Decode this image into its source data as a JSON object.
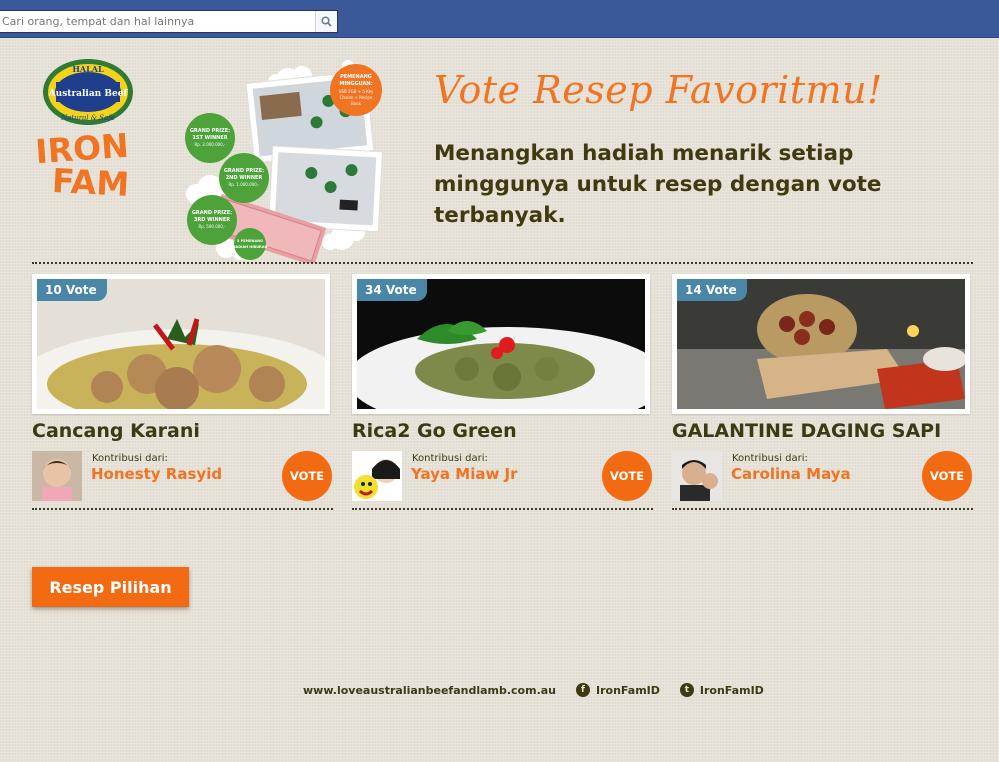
{
  "search": {
    "placeholder": "Cari orang, tempat dan hal lainnya"
  },
  "brand": {
    "halal_top": "HALAL",
    "halal_middle": "Australian Beef",
    "halal_bottom": "Natural & Safe",
    "ironfam_line1": "IRON",
    "ironfam_line2": "FAM"
  },
  "collage": {
    "weekly_winner": "PEMENANG MINGGUAN:",
    "weekly_prize": "USB 2GB + 5 Key Chains + Recipe Book",
    "grand1": "GRAND PRIZE: 1ST WINNER",
    "grand1_amount": "Uang Tunai Rp. 2.000.000,-",
    "grand2": "GRAND PRIZE: 2ND WINNER",
    "grand2_amount": "Uang Tunai Rp. 1.000.000,-",
    "grand3": "GRAND PRIZE: 3RD WINNER",
    "grand3_amount": "Uang Tunai Rp. 500.000,-",
    "consolation": "5 PEMENANG HADIAH HIBURAN"
  },
  "header": {
    "title": "Vote Resep Favoritmu!",
    "subtitle": "Menangkan hadiah menarik setiap minggunya untuk resep dengan vote terbanyak."
  },
  "recipes": [
    {
      "votes": "10 Vote",
      "title": "Cancang Karani",
      "contrib_label": "Kontribusi dari:",
      "contributor": "Honesty Rasyid",
      "vote_label": "VOTE"
    },
    {
      "votes": "34 Vote",
      "title": "Rica2 Go Green",
      "contrib_label": "Kontribusi dari:",
      "contributor": "Yaya Miaw Jr",
      "vote_label": "VOTE"
    },
    {
      "votes": "14 Vote",
      "title": "GALANTINE DAGING SAPI",
      "contrib_label": "Kontribusi dari:",
      "contributor": "Carolina Maya",
      "vote_label": "VOTE"
    }
  ],
  "resep_button": "Resep Pilihan",
  "footer": {
    "website": "www.loveaustralianbeefandlamb.com.au",
    "facebook": "IronFamID",
    "twitter": "IronFamID"
  },
  "colors": {
    "accent": "#f26a12",
    "title": "#f07422",
    "badge": "#4a86a8",
    "fb_bar": "#3b5998"
  }
}
